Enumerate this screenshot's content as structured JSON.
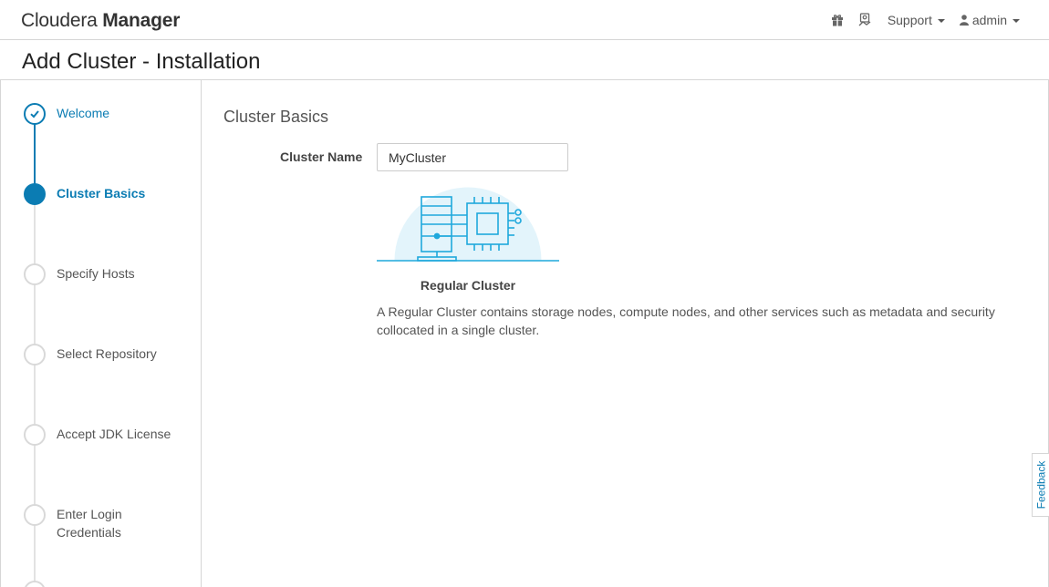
{
  "header": {
    "brand_light": "Cloudera",
    "brand_bold": "Manager",
    "gift_icon": "gift-icon",
    "support_person_icon": "support-person-icon",
    "support_label": "Support",
    "admin_label": "admin"
  },
  "page": {
    "title": "Add Cluster - Installation"
  },
  "steps": [
    {
      "label": "Welcome",
      "state": "done"
    },
    {
      "label": "Cluster Basics",
      "state": "active"
    },
    {
      "label": "Specify Hosts",
      "state": "pending"
    },
    {
      "label": "Select Repository",
      "state": "pending"
    },
    {
      "label": "Accept JDK License",
      "state": "pending"
    },
    {
      "label": "Enter Login Credentials",
      "state": "pending"
    }
  ],
  "content": {
    "section_title": "Cluster Basics",
    "cluster_name_label": "Cluster Name",
    "cluster_name_value": "MyCluster",
    "cluster_type_caption": "Regular Cluster",
    "cluster_type_description": "A Regular Cluster contains storage nodes, compute nodes, and other services such as metadata and security collocated in a single cluster."
  },
  "feedback": {
    "label": "Feedback"
  },
  "colors": {
    "accent": "#0b7cb3",
    "illustration_bg": "#e3f4fb",
    "illustration_stroke": "#1fa8dc"
  }
}
